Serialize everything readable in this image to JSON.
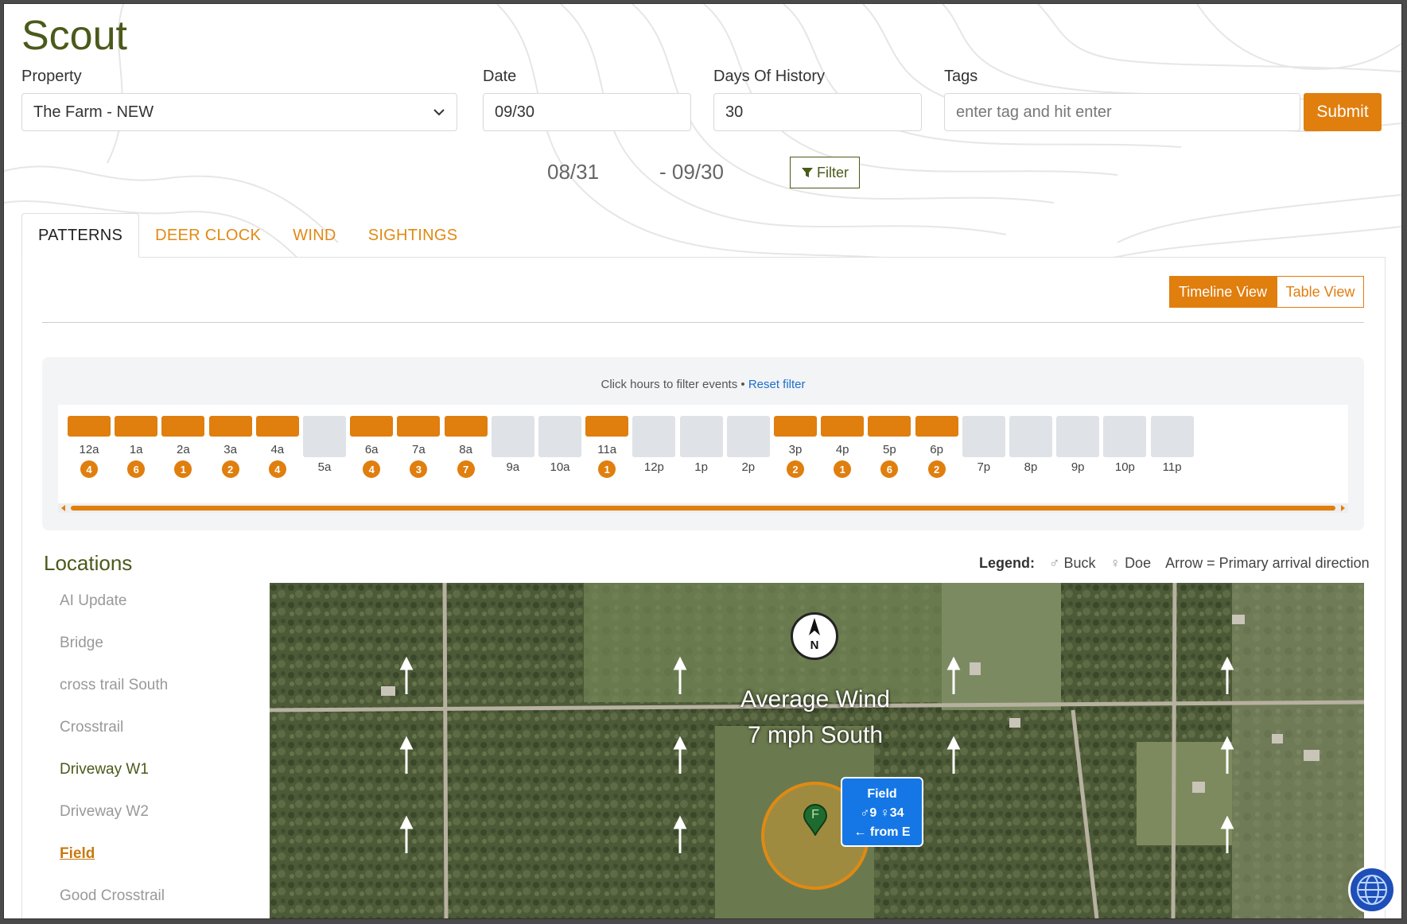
{
  "app": {
    "title": "Scout"
  },
  "filters": {
    "property_label": "Property",
    "property_value": "The Farm - NEW",
    "date_label": "Date",
    "date_value": "09/30",
    "days_label": "Days Of History",
    "days_value": "30",
    "tags_label": "Tags",
    "tags_placeholder": "enter tag and hit enter",
    "submit_label": "Submit",
    "range_start": "08/31",
    "range_end": "- 09/30",
    "filter_label": "Filter"
  },
  "tabs": [
    {
      "label": "PATTERNS",
      "active": true
    },
    {
      "label": "DEER CLOCK",
      "active": false
    },
    {
      "label": "WIND",
      "active": false
    },
    {
      "label": "SIGHTINGS",
      "active": false
    }
  ],
  "view_toggle": {
    "timeline": "Timeline View",
    "table": "Table View"
  },
  "timeline": {
    "hint": "Click hours to filter events •",
    "reset": "Reset filter",
    "hours": [
      {
        "label": "12a",
        "count": "4"
      },
      {
        "label": "1a",
        "count": "6"
      },
      {
        "label": "2a",
        "count": "1"
      },
      {
        "label": "3a",
        "count": "2"
      },
      {
        "label": "4a",
        "count": "4"
      },
      {
        "label": "5a",
        "count": ""
      },
      {
        "label": "6a",
        "count": "4"
      },
      {
        "label": "7a",
        "count": "3"
      },
      {
        "label": "8a",
        "count": "7"
      },
      {
        "label": "9a",
        "count": ""
      },
      {
        "label": "10a",
        "count": ""
      },
      {
        "label": "11a",
        "count": "1"
      },
      {
        "label": "12p",
        "count": ""
      },
      {
        "label": "1p",
        "count": ""
      },
      {
        "label": "2p",
        "count": ""
      },
      {
        "label": "3p",
        "count": "2"
      },
      {
        "label": "4p",
        "count": "1"
      },
      {
        "label": "5p",
        "count": "6"
      },
      {
        "label": "6p",
        "count": "2"
      },
      {
        "label": "7p",
        "count": ""
      },
      {
        "label": "8p",
        "count": ""
      },
      {
        "label": "9p",
        "count": ""
      },
      {
        "label": "10p",
        "count": ""
      },
      {
        "label": "11p",
        "count": ""
      }
    ]
  },
  "locations": {
    "title": "Locations",
    "legend_label": "Legend:",
    "legend_buck": "Buck",
    "legend_doe": "Doe",
    "legend_arrow": "Arrow = Primary arrival direction",
    "items": [
      {
        "label": "AI Update",
        "state": "normal"
      },
      {
        "label": "Bridge",
        "state": "normal"
      },
      {
        "label": "cross trail South",
        "state": "normal"
      },
      {
        "label": "Crosstrail",
        "state": "normal"
      },
      {
        "label": "Driveway W1",
        "state": "green"
      },
      {
        "label": "Driveway W2",
        "state": "normal"
      },
      {
        "label": "Field",
        "state": "selected"
      },
      {
        "label": "Good Crosstrail",
        "state": "normal"
      }
    ]
  },
  "map": {
    "compass": "N",
    "wind_title": "Average Wind",
    "wind_value": "7 mph South",
    "marker_letter": "F",
    "popup_title": "Field",
    "popup_counts": "♂9 ♀34",
    "popup_from": "← from E"
  },
  "colors": {
    "accent": "#e07e0e",
    "brand_green": "#4a5a1a",
    "link": "#1b6fc9",
    "popup": "#1577e6"
  }
}
